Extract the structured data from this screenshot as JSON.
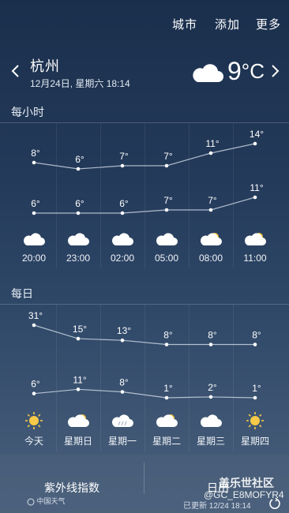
{
  "topbar": {
    "city": "城市",
    "add": "添加",
    "more": "更多"
  },
  "location": {
    "name": "杭州",
    "datetime": "12月24日, 星期六 18:14"
  },
  "current": {
    "temp": "9",
    "unit": "°C",
    "icon": "cloud-icon"
  },
  "hourly": {
    "label": "每小时",
    "times": [
      "20:00",
      "23:00",
      "02:00",
      "05:00",
      "08:00",
      "11:00"
    ],
    "high": [
      "8°",
      "6°",
      "7°",
      "7°",
      "11°",
      "14°"
    ],
    "low": [
      "6°",
      "6°",
      "6°",
      "7°",
      "7°",
      "11°"
    ],
    "high_values": [
      8,
      6,
      7,
      7,
      11,
      14
    ],
    "low_values": [
      6,
      6,
      6,
      7,
      7,
      11
    ],
    "icons": [
      "cloud-icon",
      "cloud-icon",
      "cloud-icon",
      "cloud-icon",
      "partly-sunny-icon",
      "partly-sunny-icon"
    ]
  },
  "daily": {
    "label": "每日",
    "days": [
      "今天",
      "星期日",
      "星期一",
      "星期二",
      "星期三",
      "星期四"
    ],
    "high": [
      "31°",
      "15°",
      "13°",
      "8°",
      "8°",
      "8°"
    ],
    "low": [
      "6°",
      "11°",
      "8°",
      "1°",
      "2°",
      "1°"
    ],
    "high_values": [
      31,
      15,
      13,
      8,
      8,
      8
    ],
    "low_values": [
      6,
      11,
      8,
      1,
      2,
      1
    ],
    "icons": [
      "sun-icon",
      "partly-sunny-icon",
      "cloud-rain-icon",
      "partly-sunny-icon",
      "cloud-icon",
      "sun-icon"
    ]
  },
  "bottom": {
    "uv": "紫外线指数",
    "sunrise": "日出",
    "updated": "已更新 12/24 18:14",
    "logo": "中国天气"
  },
  "watermark": {
    "line1": "盖乐世社区",
    "line2": "@GC_E8MOFYR4"
  }
}
